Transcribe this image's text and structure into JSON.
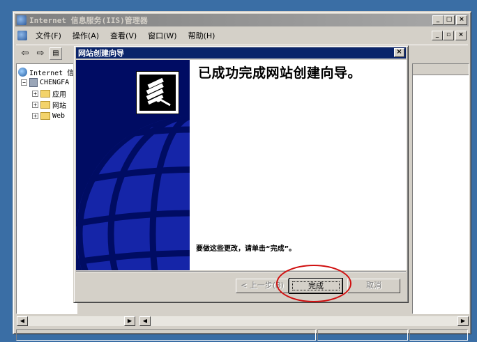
{
  "main_window": {
    "title": "Internet 信息服务(IIS)管理器",
    "menu": [
      "文件(F)",
      "操作(A)",
      "查看(V)",
      "窗口(W)",
      "帮助(H)"
    ],
    "tree": {
      "root": "Internet 信",
      "server": "CHENGFA",
      "children": [
        "应用",
        "网站",
        "Web"
      ]
    }
  },
  "wizard": {
    "title": "网站创建向导",
    "heading": "已成功完成网站创建向导。",
    "instruction": "要做这些更改，请单击“完成”。",
    "buttons": {
      "back": "< 上一步(B)",
      "finish": "完成",
      "cancel": "取消"
    }
  },
  "colors": {
    "desktop": "#3a6ea5",
    "dialog_title": "#0a246a",
    "banner": "#000c63",
    "highlight_ring": "#d01010"
  }
}
